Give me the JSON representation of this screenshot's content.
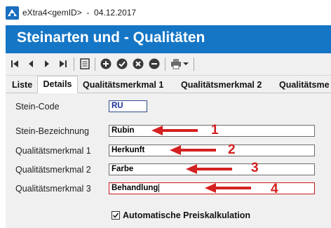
{
  "window": {
    "title": "eXtra4<gemID>  -  04.12.2017"
  },
  "banner": {
    "title": "Steinarten und - Qualitäten"
  },
  "toolbar": {
    "buttons": [
      "first-icon",
      "prev-icon",
      "next-icon",
      "last-icon",
      "list-icon",
      "add-icon",
      "confirm-icon",
      "cancel-icon",
      "delete-icon",
      "print-icon",
      "dropdown-icon"
    ]
  },
  "tabs": [
    {
      "label": "Liste"
    },
    {
      "label": "Details"
    },
    {
      "label": "Qualitätsmerkmal 1"
    },
    {
      "label": "Qualitätsmerkmal 2"
    },
    {
      "label": "Qualitätsme"
    }
  ],
  "form": {
    "stein_code": {
      "label": "Stein-Code",
      "value": "RU"
    },
    "bezeichnung": {
      "label": "Stein-Bezeichnung",
      "value": "Rubin"
    },
    "qm1": {
      "label": "Qualitätsmerkmal 1",
      "value": "Herkunft"
    },
    "qm2": {
      "label": "Qualitätsmerkmal 2",
      "value": "Farbe"
    },
    "qm3": {
      "label": "Qualitätsmerkmal 3",
      "value": "Behandlung"
    },
    "auto_preis": {
      "label": "Automatische Preiskalkulation",
      "checked": true
    }
  },
  "annotations": [
    "1",
    "2",
    "3",
    "4"
  ],
  "colors": {
    "banner": "#1576c5",
    "annotation": "#d42020"
  }
}
